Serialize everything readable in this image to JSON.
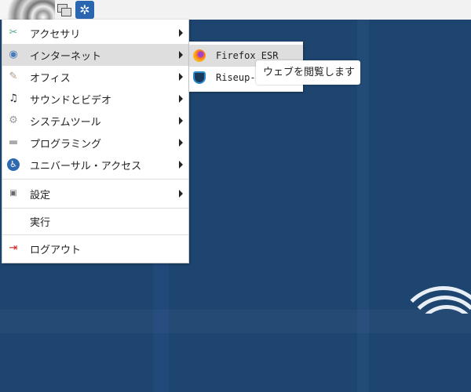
{
  "taskbar": {
    "icons": [
      "desktop-swirl-icon",
      "show-windows-icon",
      "app-launcher-icon"
    ]
  },
  "menu": {
    "items": [
      {
        "label": "アクセサリ",
        "icon": "accessories-icon",
        "submenu": true
      },
      {
        "label": "インターネット",
        "icon": "internet-globe-icon",
        "submenu": true,
        "highlighted": true
      },
      {
        "label": "オフィス",
        "icon": "office-icon",
        "submenu": true
      },
      {
        "label": "サウンドとビデオ",
        "icon": "multimedia-icon",
        "submenu": true
      },
      {
        "label": "システムツール",
        "icon": "system-tools-icon",
        "submenu": true
      },
      {
        "label": "プログラミング",
        "icon": "programming-icon",
        "submenu": true
      },
      {
        "label": "ユニバーサル・アクセス",
        "icon": "accessibility-icon",
        "submenu": true
      },
      {
        "label": "設定",
        "icon": "settings-icon",
        "submenu": true
      },
      {
        "label": "実行",
        "icon": "",
        "submenu": false
      },
      {
        "label": "ログアウト",
        "icon": "logout-icon",
        "submenu": false
      }
    ]
  },
  "submenu": {
    "items": [
      {
        "label": "Firefox ESR",
        "icon": "firefox-icon",
        "highlighted": true
      },
      {
        "label": "Riseup-v",
        "icon": "riseup-vpn-icon"
      }
    ]
  },
  "tooltip": "ウェブを閲覧します",
  "colors": {
    "desktop": "#1f4570",
    "highlight": "#dedede"
  }
}
